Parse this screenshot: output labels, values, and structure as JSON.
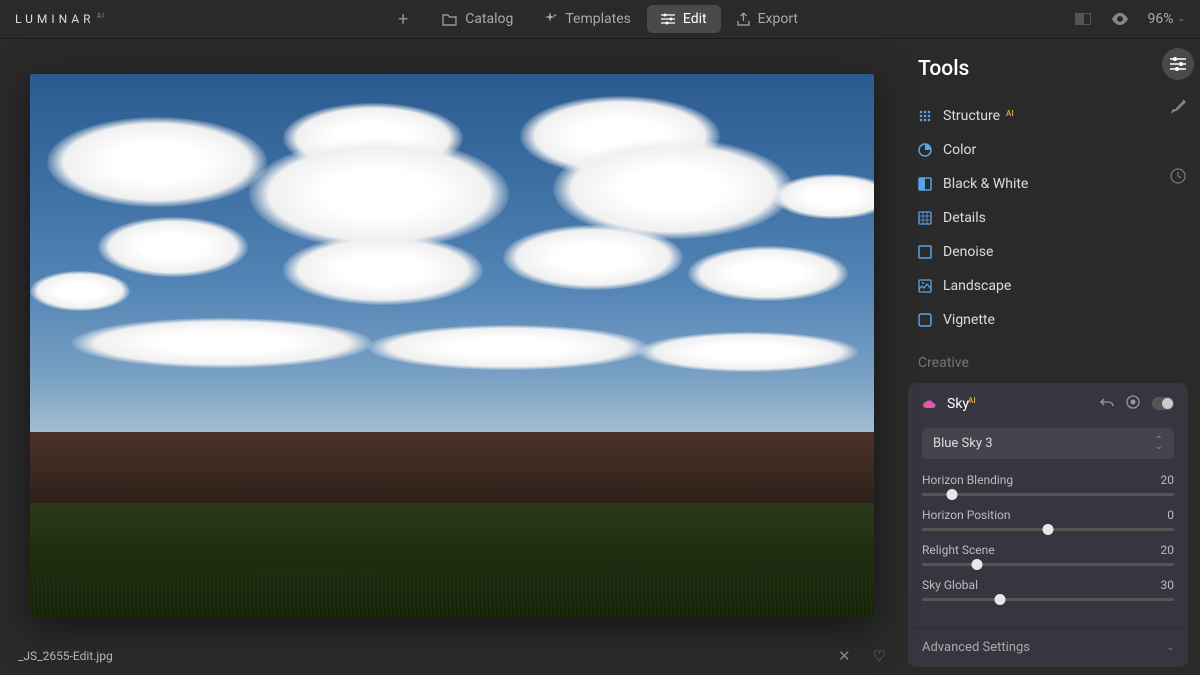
{
  "app": {
    "name": "LUMINAR",
    "suffix": "AI"
  },
  "nav": {
    "catalog": "Catalog",
    "templates": "Templates",
    "edit": "Edit",
    "export": "Export"
  },
  "header": {
    "zoom": "96%"
  },
  "filename": "_JS_2655-Edit.jpg",
  "tools": {
    "title": "Tools",
    "items": [
      {
        "label": "Structure",
        "ai": true,
        "icon": "structure"
      },
      {
        "label": "Color",
        "ai": false,
        "icon": "color"
      },
      {
        "label": "Black & White",
        "ai": false,
        "icon": "bw"
      },
      {
        "label": "Details",
        "ai": false,
        "icon": "details"
      },
      {
        "label": "Denoise",
        "ai": false,
        "icon": "denoise"
      },
      {
        "label": "Landscape",
        "ai": false,
        "icon": "landscape"
      },
      {
        "label": "Vignette",
        "ai": false,
        "icon": "vignette"
      }
    ],
    "section_creative": "Creative"
  },
  "sky_panel": {
    "title": "Sky",
    "ai": true,
    "preset": "Blue Sky 3",
    "sliders": [
      {
        "label": "Horizon Blending",
        "value": 20,
        "pos": 12
      },
      {
        "label": "Horizon Position",
        "value": 0,
        "pos": 50
      },
      {
        "label": "Relight Scene",
        "value": 20,
        "pos": 22
      },
      {
        "label": "Sky Global",
        "value": 30,
        "pos": 31
      }
    ],
    "advanced": "Advanced Settings"
  }
}
